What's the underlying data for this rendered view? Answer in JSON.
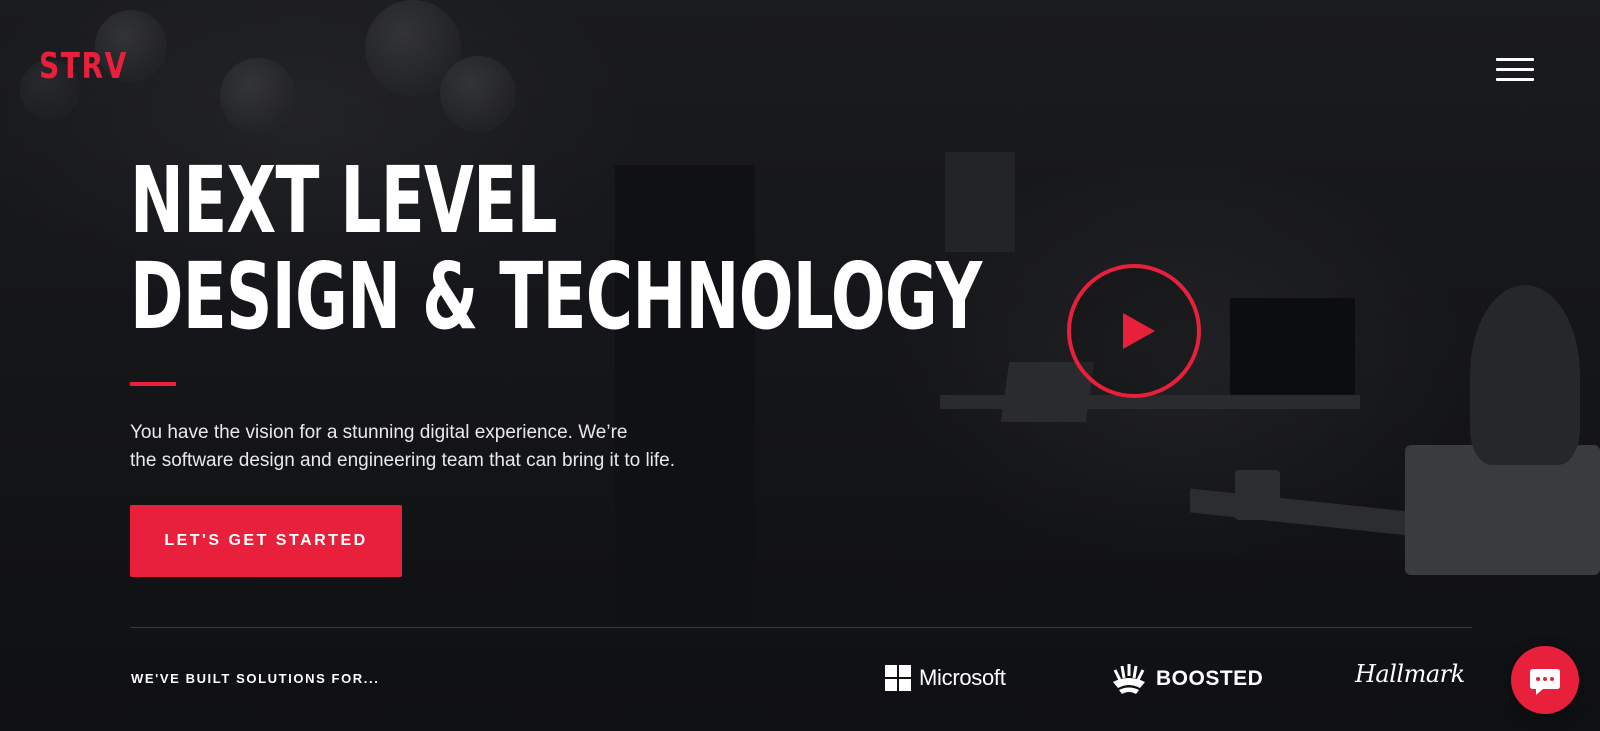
{
  "brand": {
    "logo_text": "STRV",
    "accent_color": "#e8203c"
  },
  "header": {
    "menu_icon": "hamburger-menu-icon"
  },
  "hero": {
    "headline_lines": [
      "NEXT LEVEL",
      "DESIGN & TECHNOLOGY"
    ],
    "subtext_lines": [
      "You have the vision for a stunning digital experience. We’re",
      "the software design and engineering team that can bring it to life."
    ],
    "cta_label": "LET'S GET STARTED",
    "play_icon": "play-icon"
  },
  "clients": {
    "label": "WE'VE BUILT SOLUTIONS FOR...",
    "logos": [
      {
        "name": "Microsoft",
        "icon": "windows-logo-icon"
      },
      {
        "name": "BOOSTED",
        "icon": "boosted-logo-icon"
      },
      {
        "name": "Hallmark",
        "icon": "hallmark-logo"
      }
    ]
  },
  "chat": {
    "icon": "chat-bubble-icon"
  }
}
